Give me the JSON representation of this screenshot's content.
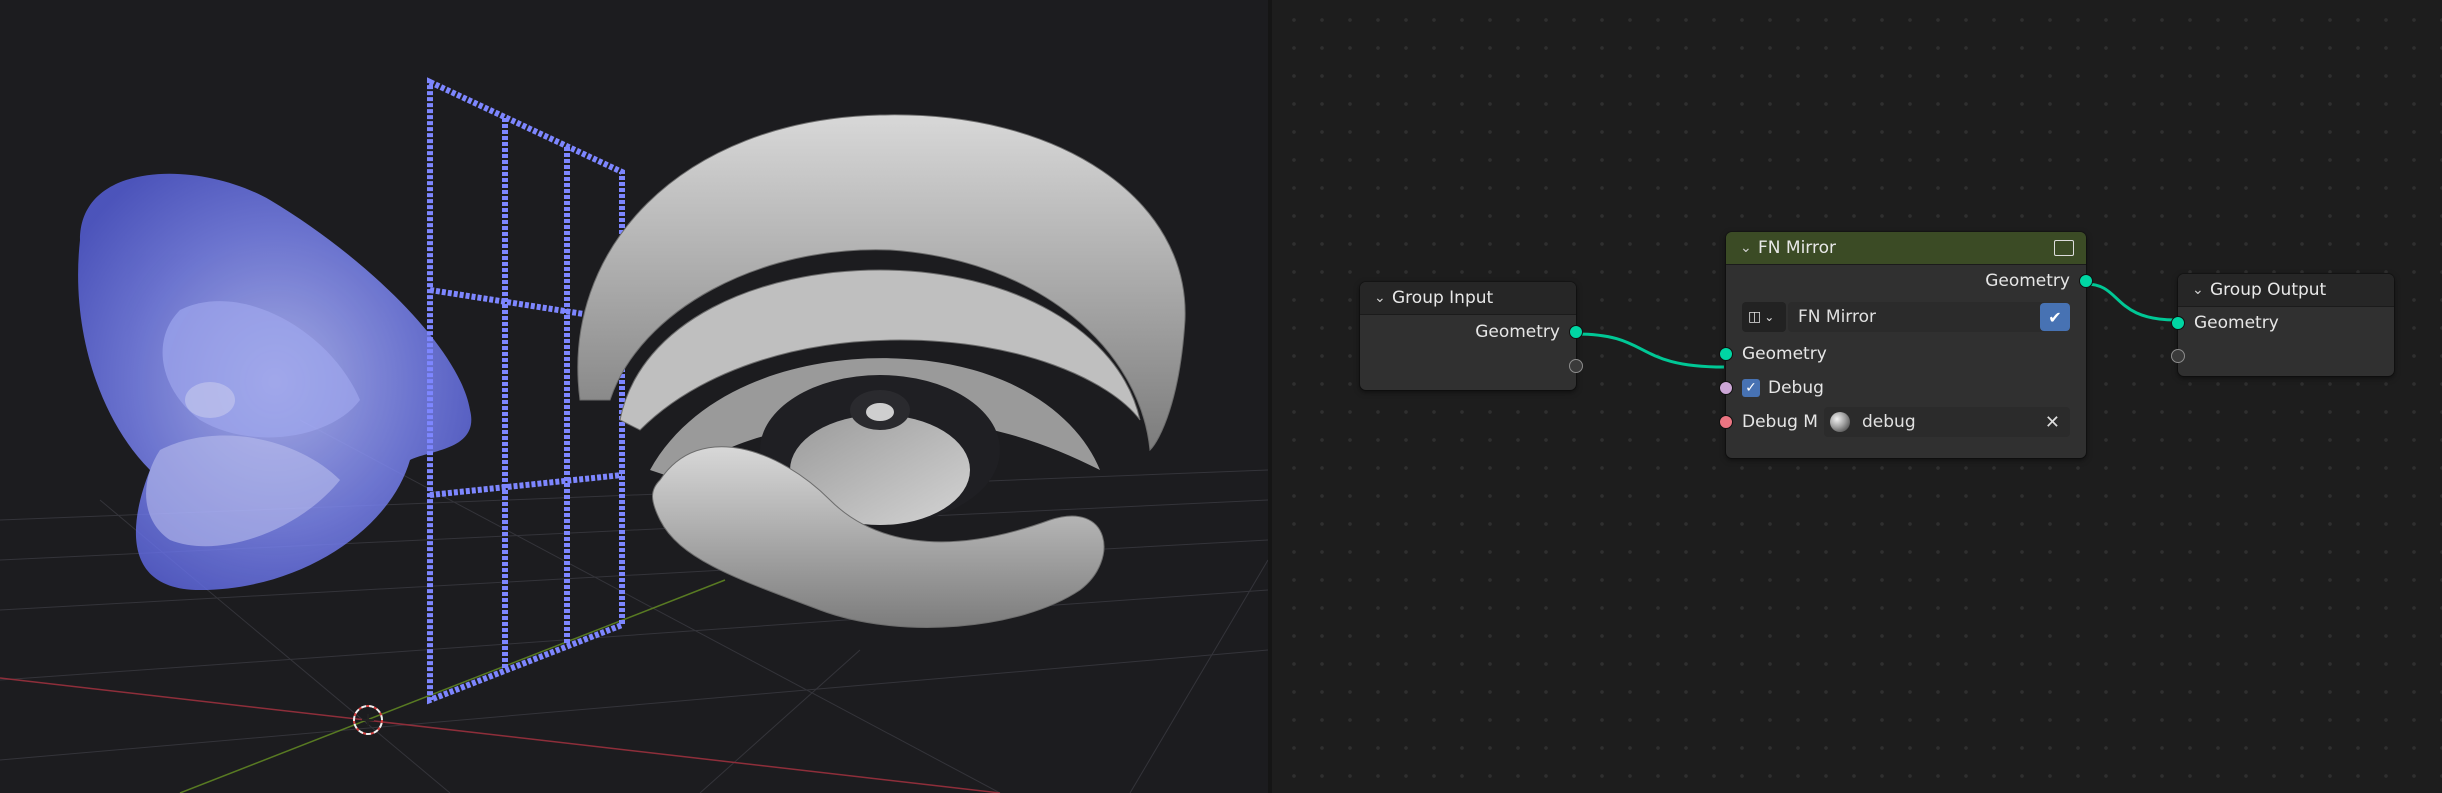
{
  "viewport": {
    "description_hidden": "3D viewport",
    "colors": {
      "background": "#1c1c1f",
      "blue_object": "#6e78f0",
      "gray_object": "#bdbdbd",
      "grid_line": "#3a3a3e",
      "x_axis": "#b03a46",
      "y_axis": "#6d8f27"
    }
  },
  "node_editor": {
    "group_input": {
      "title": "Group Input",
      "outputs": [
        "Geometry"
      ]
    },
    "fn_mirror": {
      "title": "FN Mirror",
      "output": "Geometry",
      "datablock_name": "FN Mirror",
      "inputs": {
        "geometry": "Geometry",
        "debug": "Debug",
        "debug_material_label": "Debug M",
        "debug_material_value": "debug"
      },
      "debug_checked": true
    },
    "group_output": {
      "title": "Group Output",
      "inputs": [
        "Geometry"
      ]
    },
    "colors": {
      "geometry_socket": "#00d6a3",
      "boolean_socket": "#cca6d6",
      "material_socket": "#eb7582",
      "group_header": "#3b4b25",
      "link": "#00c896"
    }
  }
}
